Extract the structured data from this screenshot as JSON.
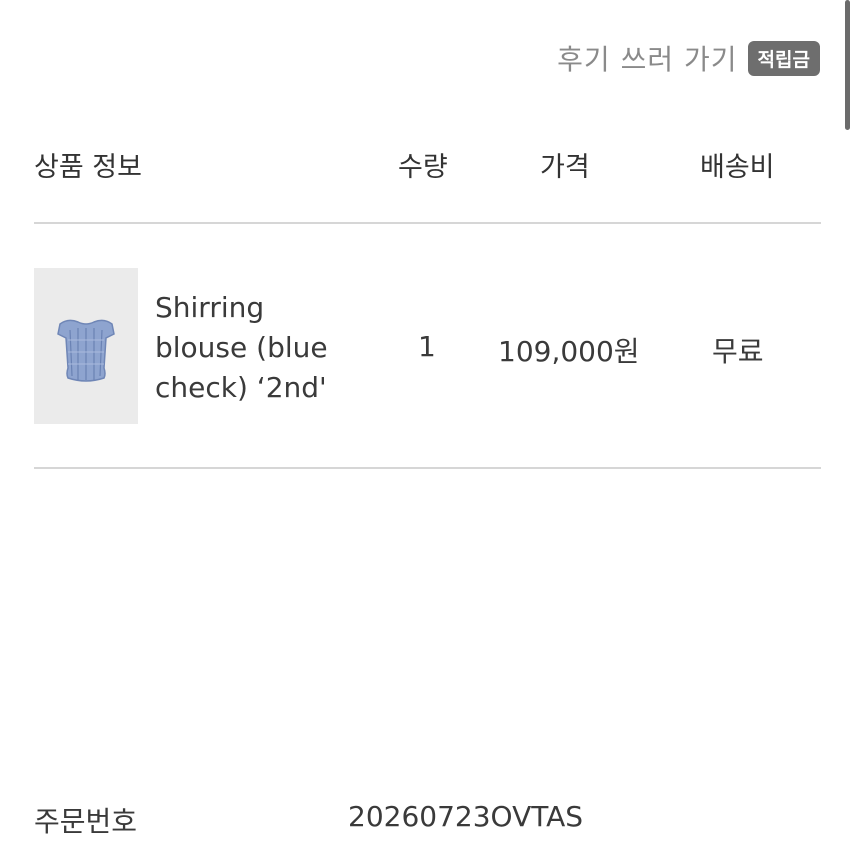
{
  "review": {
    "link_label": "후기 쓰러 가기",
    "badge_label": "적립금"
  },
  "table": {
    "headers": {
      "product": "상품 정보",
      "quantity": "수량",
      "price": "가격",
      "shipping": "배송비"
    },
    "rows": [
      {
        "product_name": "Shirring blouse (blue check) ‘2nd'",
        "quantity": "1",
        "price": "109,000원",
        "shipping": "무료"
      }
    ]
  },
  "order": {
    "label": "주문번호",
    "number": "20260723OVTAS"
  },
  "colors": {
    "badge_bg": "#6e6e6e",
    "divider": "#d6d6d6",
    "muted_text": "#8a8a8a",
    "body_text": "#3a3a3a"
  }
}
